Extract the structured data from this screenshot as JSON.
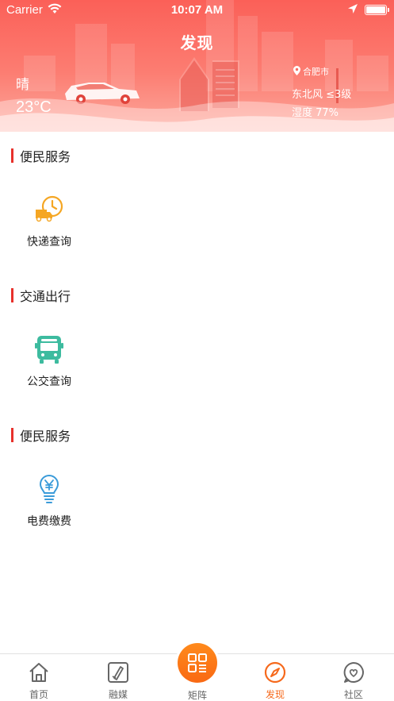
{
  "status_bar": {
    "carrier": "Carrier",
    "time": "10:07 AM"
  },
  "header": {
    "title": "发现",
    "weather": {
      "condition": "晴",
      "temperature": "23°C",
      "city": "合肥市",
      "wind": "东北风 ≤3级",
      "humidity": "湿度 77%"
    }
  },
  "sections": [
    {
      "title": "便民服务",
      "items": [
        {
          "label": "快递查询",
          "icon": "delivery-truck-clock-icon"
        }
      ]
    },
    {
      "title": "交通出行",
      "items": [
        {
          "label": "公交查询",
          "icon": "bus-icon"
        }
      ]
    },
    {
      "title": "便民服务",
      "items": [
        {
          "label": "电费缴费",
          "icon": "lightbulb-yuan-icon"
        }
      ]
    }
  ],
  "tabbar": {
    "tabs": [
      {
        "label": "首页",
        "icon": "home-icon"
      },
      {
        "label": "融媒",
        "icon": "media-icon"
      },
      {
        "label": "矩阵",
        "icon": "grid-icon"
      },
      {
        "label": "发现",
        "icon": "compass-icon"
      },
      {
        "label": "社区",
        "icon": "heart-chat-icon"
      }
    ],
    "active_tab": "发现"
  },
  "colors": {
    "header_gradient_top": "#fb6058",
    "header_gradient_bottom": "#fda89c",
    "section_accent": "#e8312b",
    "tab_active": "#f6691c",
    "tab_center_button": "#f96913",
    "delivery_icon": "#f5a623",
    "bus_icon": "#3dbb9f",
    "electric_icon": "#3a9bd9"
  }
}
